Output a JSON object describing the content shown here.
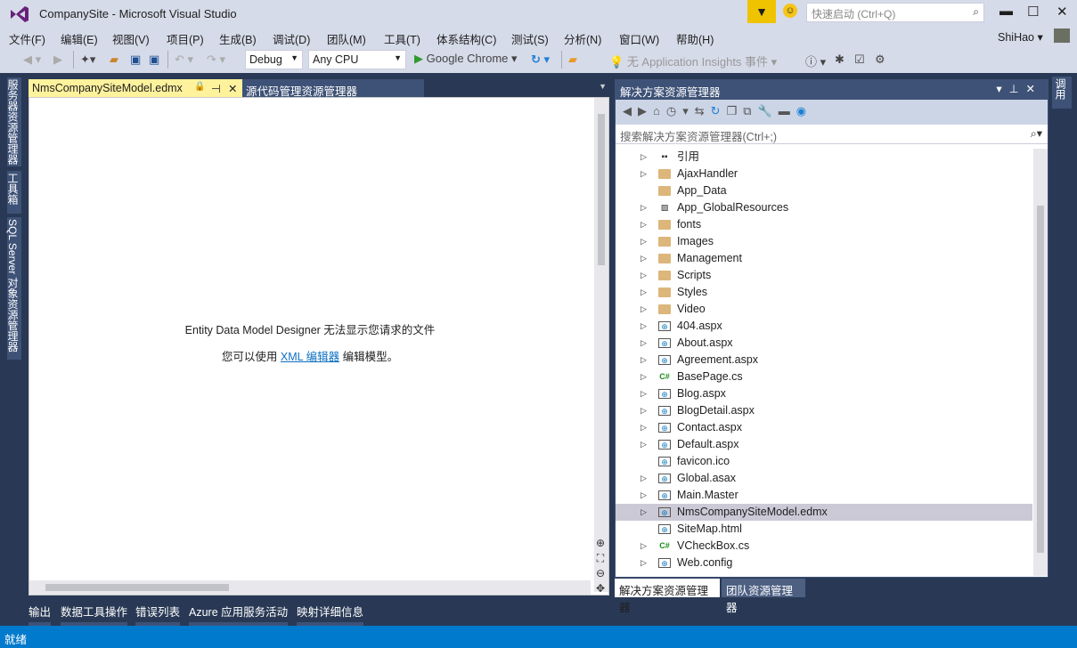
{
  "window": {
    "title": "CompanySite - Microsoft Visual Studio",
    "quick_launch_placeholder": "快速启动 (Ctrl+Q)",
    "user": "ShiHao"
  },
  "menu": [
    "文件(F)",
    "编辑(E)",
    "视图(V)",
    "项目(P)",
    "生成(B)",
    "调试(D)",
    "团队(M)",
    "工具(T)",
    "体系结构(C)",
    "测试(S)",
    "分析(N)",
    "窗口(W)",
    "帮助(H)"
  ],
  "toolbar": {
    "config": "Debug",
    "platform": "Any CPU",
    "run_target": "Google Chrome",
    "insights": "无 Application Insights 事件"
  },
  "left_tabs": [
    "服务器资源管理器",
    "工具箱",
    "SQL Server 对象资源管理器"
  ],
  "right_tab": "调用",
  "doc_tabs": {
    "active": "NmsCompanySiteModel.edmx",
    "other": "源代码管理资源管理器"
  },
  "editor": {
    "message": "Entity Data Model Designer 无法显示您请求的文件",
    "hint_prefix": "您可以使用",
    "hint_link": "XML 编辑器",
    "hint_suffix": "编辑模型。"
  },
  "solution_explorer": {
    "title": "解决方案资源管理器",
    "search_placeholder": "搜索解决方案资源管理器(Ctrl+;)",
    "items": [
      {
        "label": "引用",
        "icon": "ref",
        "expandable": true
      },
      {
        "label": "AjaxHandler",
        "icon": "folder",
        "expandable": true
      },
      {
        "label": "App_Data",
        "icon": "folder",
        "expandable": false
      },
      {
        "label": "App_GlobalResources",
        "icon": "image",
        "expandable": true
      },
      {
        "label": "fonts",
        "icon": "folder",
        "expandable": true
      },
      {
        "label": "Images",
        "icon": "folder",
        "expandable": true
      },
      {
        "label": "Management",
        "icon": "folder",
        "expandable": true
      },
      {
        "label": "Scripts",
        "icon": "folder",
        "expandable": true
      },
      {
        "label": "Styles",
        "icon": "folder",
        "expandable": true
      },
      {
        "label": "Video",
        "icon": "folder",
        "expandable": true
      },
      {
        "label": "404.aspx",
        "icon": "file",
        "expandable": true
      },
      {
        "label": "About.aspx",
        "icon": "file",
        "expandable": true
      },
      {
        "label": "Agreement.aspx",
        "icon": "file",
        "expandable": true
      },
      {
        "label": "BasePage.cs",
        "icon": "cs",
        "expandable": true
      },
      {
        "label": "Blog.aspx",
        "icon": "file",
        "expandable": true
      },
      {
        "label": "BlogDetail.aspx",
        "icon": "file",
        "expandable": true
      },
      {
        "label": "Contact.aspx",
        "icon": "file",
        "expandable": true
      },
      {
        "label": "Default.aspx",
        "icon": "file",
        "expandable": true
      },
      {
        "label": "favicon.ico",
        "icon": "file",
        "expandable": false
      },
      {
        "label": "Global.asax",
        "icon": "file",
        "expandable": true
      },
      {
        "label": "Main.Master",
        "icon": "file",
        "expandable": true
      },
      {
        "label": "NmsCompanySiteModel.edmx",
        "icon": "file",
        "expandable": true,
        "selected": true
      },
      {
        "label": "SiteMap.html",
        "icon": "file",
        "expandable": false
      },
      {
        "label": "VCheckBox.cs",
        "icon": "cs",
        "expandable": true
      },
      {
        "label": "Web.config",
        "icon": "file",
        "expandable": true
      }
    ],
    "tabs": [
      "解决方案资源管理器",
      "团队资源管理器"
    ]
  },
  "bottom_tabs": [
    "输出",
    "数据工具操作",
    "错误列表",
    "Azure 应用服务活动",
    "映射详细信息"
  ],
  "status": "就绪",
  "colors": {
    "accent": "#007acc",
    "chrome": "#d6dbe9",
    "dark": "#293955",
    "active_tab": "#fff29d"
  }
}
